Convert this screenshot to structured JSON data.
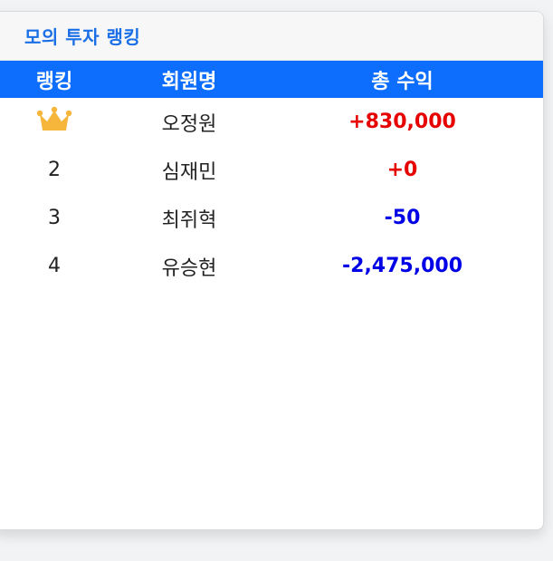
{
  "panel": {
    "title": "모의 투자 랭킹"
  },
  "table": {
    "headers": [
      "랭킹",
      "회원명",
      "총 수익"
    ],
    "rows": [
      {
        "rank": "",
        "rank_icon": "crown-icon",
        "name": "오정원",
        "profit": "+830,000",
        "profit_color": "#e60000"
      },
      {
        "rank": "2",
        "name": "심재민",
        "profit": "+0",
        "profit_color": "#e60000"
      },
      {
        "rank": "3",
        "name": "최쥐혁",
        "profit": "-50",
        "profit_color": "#0000e6"
      },
      {
        "rank": "4",
        "name": "유승현",
        "profit": "-2,475,000",
        "profit_color": "#0000e6"
      }
    ]
  },
  "colors": {
    "accent": "#0d6efd",
    "title": "#1a6fe6",
    "crown": "#f6b53b",
    "positive": "#e60000",
    "negative": "#0000e6"
  }
}
